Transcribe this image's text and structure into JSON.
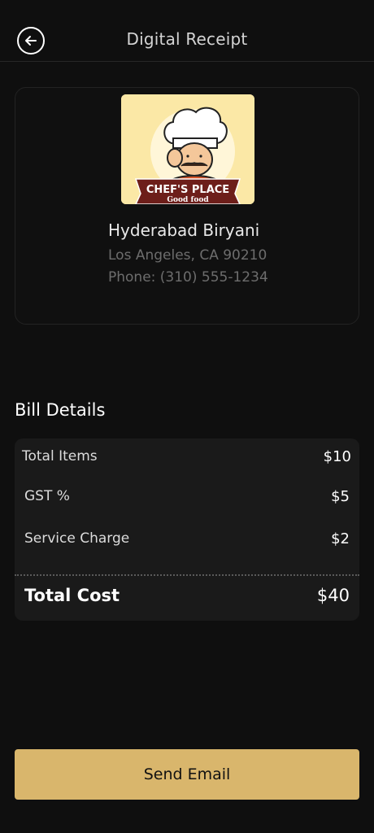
{
  "header": {
    "title": "Digital Receipt",
    "back_icon": "arrow-left-icon"
  },
  "restaurant": {
    "logo_title": "CHEF'S PLACE",
    "logo_subtitle": "Good food",
    "name": "Hyderabad Biryani",
    "address": "Los Angeles, CA 90210",
    "phone": "Phone: (310) 555-1234"
  },
  "bill": {
    "section_title": "Bill Details",
    "items": [
      {
        "label": "Total Items",
        "value": "$10"
      },
      {
        "label": "GST %",
        "value": "$5"
      },
      {
        "label": "Service Charge",
        "value": "$2"
      }
    ],
    "total_label": "Total Cost",
    "total_value": "$40"
  },
  "actions": {
    "send_email": "Send Email"
  },
  "colors": {
    "background": "#0f0f0f",
    "card": "#1a1a1a",
    "accent": "#d9b66c"
  }
}
